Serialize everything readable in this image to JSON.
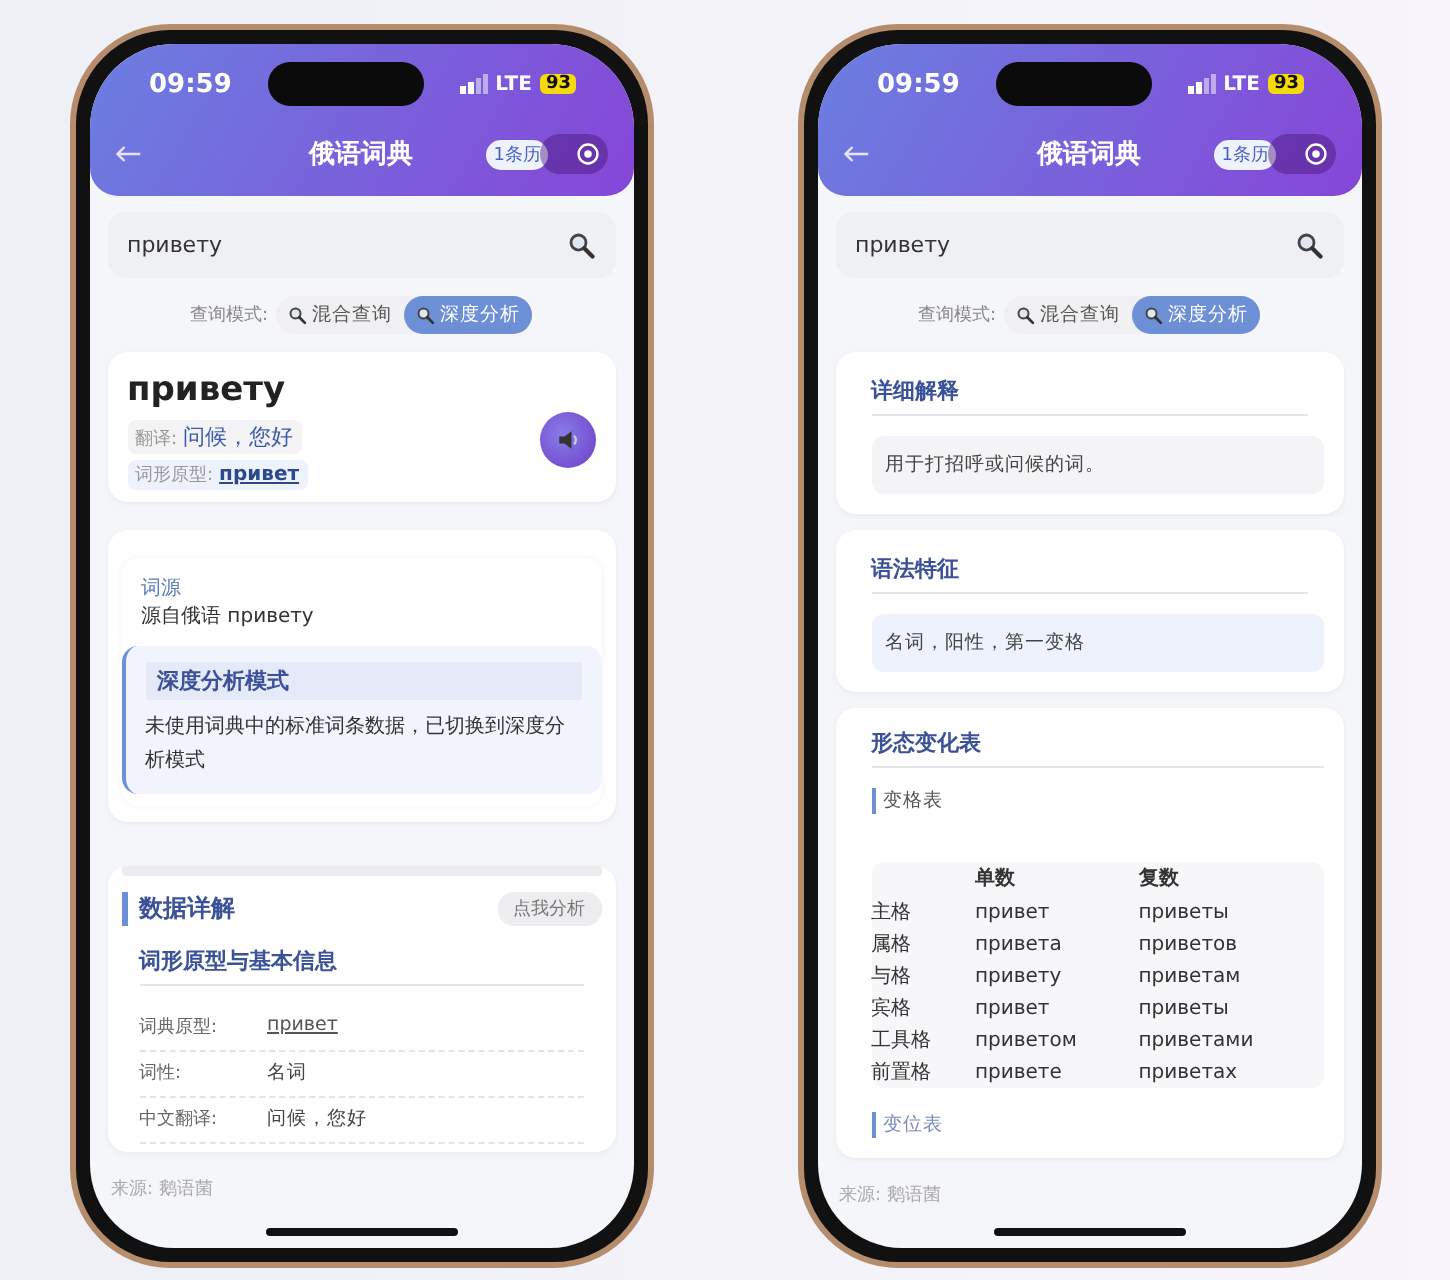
{
  "phones": [
    {
      "status_bar": {
        "time": "09:59",
        "network": "LTE",
        "battery": "93"
      },
      "header": {
        "title": "俄语词典",
        "history": "1条历"
      },
      "search": {
        "value": "привету"
      },
      "mode": {
        "label": "查询模式:",
        "options": [
          {
            "label": "混合查询",
            "selected": false
          },
          {
            "label": "深度分析",
            "selected": true
          }
        ]
      },
      "sections": [
        {
          "kind": "word",
          "headword": "привету",
          "translation_label": "翻译:",
          "translation": "问候，您好",
          "lemma_label": "词形原型:",
          "lemma": "привет"
        },
        {
          "kind": "etymology",
          "label": "词源",
          "text": "源自俄语 привету",
          "note": {
            "title": "深度分析模式",
            "text": "未使用词典中的标准词条数据，已切换到深度分析模式"
          }
        },
        {
          "kind": "details",
          "title": "数据详解",
          "button": "点我分析",
          "subtitle": "词形原型与基本信息",
          "rows": [
            {
              "label": "词典原型:",
              "value": "привет",
              "kind": "link"
            },
            {
              "label": "词性:",
              "value": "名词",
              "kind": "plain"
            },
            {
              "label": "中文翻译:",
              "value": "问候，您好",
              "kind": "plain"
            }
          ]
        }
      ],
      "footer": "来源: 鹅语菌"
    },
    {
      "status_bar": {
        "time": "09:59",
        "network": "LTE",
        "battery": "93"
      },
      "header": {
        "title": "俄语词典",
        "history": "1条历"
      },
      "search": {
        "value": "привету"
      },
      "mode": {
        "label": "查询模式:",
        "options": [
          {
            "label": "混合查询",
            "selected": false
          },
          {
            "label": "深度分析",
            "selected": true
          }
        ]
      },
      "sections": [
        {
          "kind": "explanation",
          "title": "详细解释",
          "text": "用于打招呼或问候的词。"
        },
        {
          "kind": "feature",
          "title": "语法特征",
          "text": "名词，阳性，第一变格"
        },
        {
          "kind": "table_card",
          "title": "形态变化表",
          "subheading": "变格表",
          "columns": [
            "单数",
            "复数"
          ],
          "rows": [
            {
              "case": "主格",
              "singular": "привет",
              "plural": "приветы"
            },
            {
              "case": "属格",
              "singular": "привета",
              "plural": "приветов"
            },
            {
              "case": "与格",
              "singular": "привету",
              "plural": "приветам"
            },
            {
              "case": "宾格",
              "singular": "привет",
              "plural": "приветы"
            },
            {
              "case": "工具格",
              "singular": "приветом",
              "plural": "приветами"
            },
            {
              "case": "前置格",
              "singular": "привете",
              "plural": "приветах"
            }
          ],
          "next_subheading": "变位表"
        }
      ],
      "footer": "来源: 鹅语菌"
    }
  ]
}
